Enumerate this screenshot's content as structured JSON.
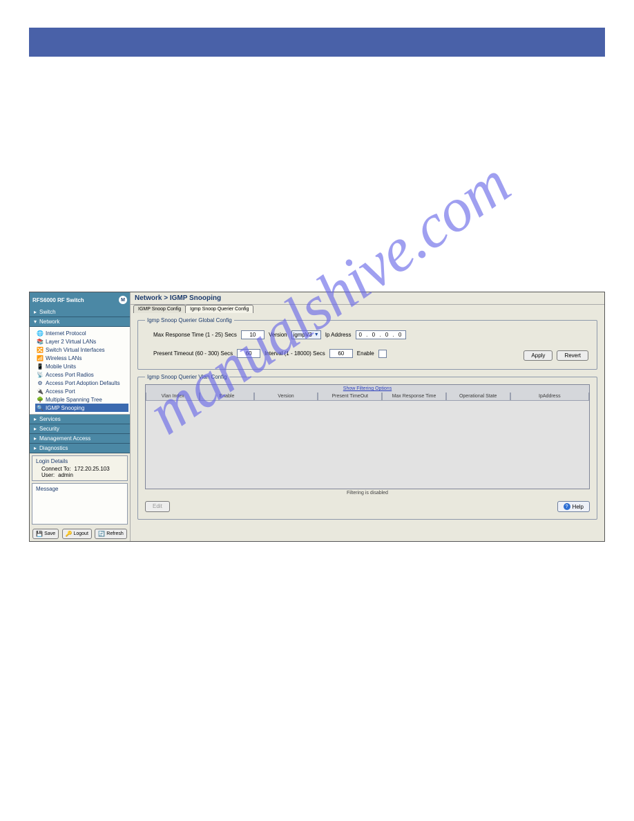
{
  "topbar": {},
  "brand": {
    "title": "RFS6000 RF Switch"
  },
  "nav": {
    "switch": "Switch",
    "network": "Network",
    "services": "Services",
    "security": "Security",
    "mgmt": "Management Access",
    "diag": "Diagnostics",
    "tree": {
      "internet_protocol": "Internet Protocol",
      "layer2_vlans": "Layer 2 Virtual LANs",
      "switch_virtual_ifaces": "Switch Virtual Interfaces",
      "wireless_lans": "Wireless LANs",
      "mobile_units": "Mobile Units",
      "access_port_radios": "Access Port Radios",
      "access_port_adoption": "Access Port Adoption Defaults",
      "access_port": "Access Port",
      "multiple_spanning_tree": "Multiple Spanning Tree",
      "igmp_snooping": "IGMP Snooping"
    }
  },
  "login_details": {
    "header": "Login Details",
    "connect_to_label": "Connect To:",
    "connect_to_value": "172.20.25.103",
    "user_label": "User:",
    "user_value": "admin"
  },
  "message": {
    "header": "Message"
  },
  "footer_buttons": {
    "save": "Save",
    "logout": "Logout",
    "refresh": "Refresh"
  },
  "breadcrumb": "Network > IGMP Snooping",
  "tabs": {
    "igmp_snoop_config": "IGMP Snoop Config",
    "igmp_snoop_querier_config": "Igmp Snoop Querier Config"
  },
  "global_config": {
    "legend": "Igmp Snoop Querier Global Config",
    "max_response_label": "Max Response Time (1 - 25) Secs",
    "max_response_value": "10",
    "version_label": "Version",
    "version_value": "igmpV3",
    "ip_label": "Ip Address",
    "ip_value": "0 . 0 . 0 . 0",
    "present_timeout_label": "Present Timeout (60 - 300) Secs",
    "present_timeout_value": "60",
    "interval_label": "Interval (1 - 18000) Secs",
    "interval_value": "60",
    "enable_label": "Enable",
    "apply": "Apply",
    "revert": "Revert"
  },
  "vlan_config": {
    "legend": "Igmp Snoop Querier Vlan Config",
    "filter_options": "Show Filtering Options",
    "columns": {
      "vlan_index": "Vlan Index",
      "enable": "Enable",
      "version": "Version",
      "present_timeout": "Present TimeOut",
      "max_response_time": "Max Response Time",
      "operational_state": "Operational State",
      "ip_address": "IpAddress"
    },
    "filter_status": "Filtering is disabled",
    "edit": "Edit",
    "help": "Help"
  },
  "watermark": "manualshive.com"
}
